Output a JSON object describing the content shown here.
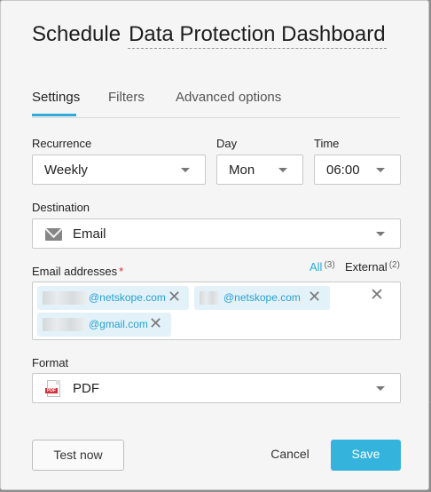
{
  "title": {
    "prefix": "Schedule",
    "report_name": "Data Protection Dashboard"
  },
  "tabs": [
    {
      "label": "Settings",
      "active": true
    },
    {
      "label": "Filters",
      "active": false
    },
    {
      "label": "Advanced options",
      "active": false
    }
  ],
  "recurrence": {
    "label": "Recurrence",
    "value": "Weekly"
  },
  "day": {
    "label": "Day",
    "value": "Mon"
  },
  "time": {
    "label": "Time",
    "value": "06:00"
  },
  "destination": {
    "label": "Destination",
    "value": "Email",
    "icon": "envelope-icon"
  },
  "emails": {
    "label": "Email addresses",
    "required_mark": "*",
    "filter_all": {
      "label": "All",
      "count": "(3)"
    },
    "filter_external": {
      "label": "External",
      "count": "(2)"
    },
    "chips": [
      {
        "domain": "@netskope.com"
      },
      {
        "domain": "@netskope.com"
      },
      {
        "domain": "@gmail.com"
      }
    ],
    "clear_glyph": "✕",
    "remove_glyph": "✕"
  },
  "format": {
    "label": "Format",
    "value": "PDF",
    "icon": "pdf-file-icon",
    "icon_tag": "PDF"
  },
  "buttons": {
    "test_now": "Test now",
    "cancel": "Cancel",
    "save": "Save"
  },
  "colors": {
    "accent": "#34b4dc",
    "link": "#2ea9d8",
    "required": "#d0303a",
    "chip_bg": "#e3f2f9"
  }
}
